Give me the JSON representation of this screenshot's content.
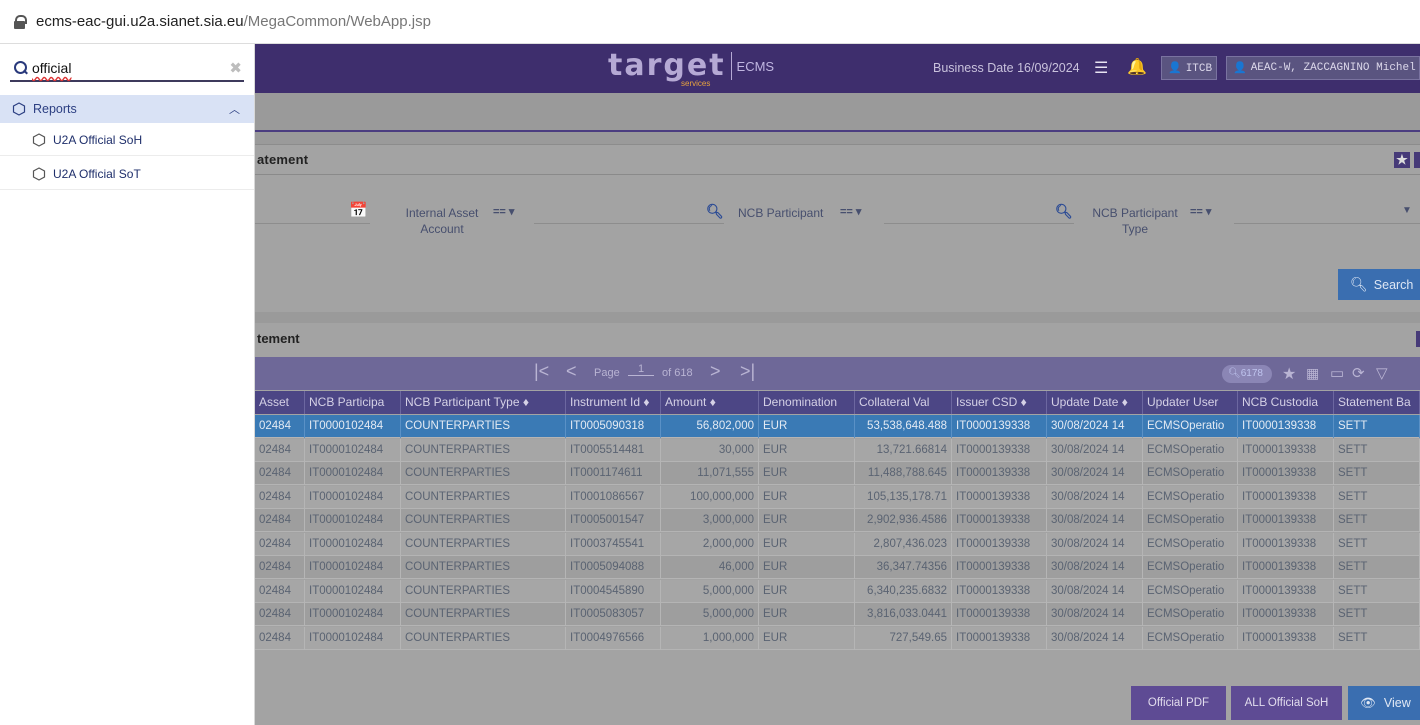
{
  "browser": {
    "url_host": "ecms-eac-gui.u2a.sianet.sia.eu",
    "url_path": "/MegaCommon/WebApp.jsp"
  },
  "header": {
    "logo_text": "target",
    "logo_sub": "services",
    "logo_brand": "ECMS",
    "business_date": "Business Date 16/09/2024",
    "party_button": "ITCB ▾",
    "user_button": "AEAC-W, ZACCAGNINO Michel"
  },
  "sidebar": {
    "search_value": "official",
    "category": "Reports",
    "items": [
      "U2A Official SoH",
      "U2A Official SoT"
    ]
  },
  "search_panel": {
    "title": "atement",
    "filters": {
      "internal_asset_label": "Internal Asset\nAccount",
      "internal_asset_op": "== ▾",
      "ncb_participant_label": "NCB Participant",
      "ncb_participant_op": "== ▾",
      "ncb_type_label": "NCB Participant\nType",
      "ncb_type_op": "== ▾"
    },
    "search_button": "Search"
  },
  "results_panel": {
    "title": "tement",
    "pager": {
      "page_label": "Page",
      "page_value": "1",
      "of_label": "of 618",
      "count": "6178"
    },
    "columns": [
      "Asset",
      "NCB Participa",
      "NCB Participant Type ♦",
      "Instrument Id ♦",
      "Amount ♦",
      "Denomination",
      "Collateral Val",
      "Issuer CSD ♦",
      "Update Date ♦",
      "Updater User",
      "NCB Custodia",
      "Statement Ba"
    ],
    "rows": [
      [
        "02484",
        "IT0000102484",
        "COUNTERPARTIES",
        "IT0005090318",
        "56,802,000",
        "EUR",
        "53,538,648.488",
        "IT0000139338",
        "30/08/2024 14",
        "ECMSOperatio",
        "IT0000139338",
        "SETT"
      ],
      [
        "02484",
        "IT0000102484",
        "COUNTERPARTIES",
        "IT0005514481",
        "30,000",
        "EUR",
        "13,721.66814",
        "IT0000139338",
        "30/08/2024 14",
        "ECMSOperatio",
        "IT0000139338",
        "SETT"
      ],
      [
        "02484",
        "IT0000102484",
        "COUNTERPARTIES",
        "IT0001174611",
        "11,071,555",
        "EUR",
        "11,488,788.645",
        "IT0000139338",
        "30/08/2024 14",
        "ECMSOperatio",
        "IT0000139338",
        "SETT"
      ],
      [
        "02484",
        "IT0000102484",
        "COUNTERPARTIES",
        "IT0001086567",
        "100,000,000",
        "EUR",
        "105,135,178.71",
        "IT0000139338",
        "30/08/2024 14",
        "ECMSOperatio",
        "IT0000139338",
        "SETT"
      ],
      [
        "02484",
        "IT0000102484",
        "COUNTERPARTIES",
        "IT0005001547",
        "3,000,000",
        "EUR",
        "2,902,936.4586",
        "IT0000139338",
        "30/08/2024 14",
        "ECMSOperatio",
        "IT0000139338",
        "SETT"
      ],
      [
        "02484",
        "IT0000102484",
        "COUNTERPARTIES",
        "IT0003745541",
        "2,000,000",
        "EUR",
        "2,807,436.023",
        "IT0000139338",
        "30/08/2024 14",
        "ECMSOperatio",
        "IT0000139338",
        "SETT"
      ],
      [
        "02484",
        "IT0000102484",
        "COUNTERPARTIES",
        "IT0005094088",
        "46,000",
        "EUR",
        "36,347.74356",
        "IT0000139338",
        "30/08/2024 14",
        "ECMSOperatio",
        "IT0000139338",
        "SETT"
      ],
      [
        "02484",
        "IT0000102484",
        "COUNTERPARTIES",
        "IT0004545890",
        "5,000,000",
        "EUR",
        "6,340,235.6832",
        "IT0000139338",
        "30/08/2024 14",
        "ECMSOperatio",
        "IT0000139338",
        "SETT"
      ],
      [
        "02484",
        "IT0000102484",
        "COUNTERPARTIES",
        "IT0005083057",
        "5,000,000",
        "EUR",
        "3,816,033.0441",
        "IT0000139338",
        "30/08/2024 14",
        "ECMSOperatio",
        "IT0000139338",
        "SETT"
      ],
      [
        "02484",
        "IT0000102484",
        "COUNTERPARTIES",
        "IT0004976566",
        "1,000,000",
        "EUR",
        "727,549.65",
        "IT0000139338",
        "30/08/2024 14",
        "ECMSOperatio",
        "IT0000139338",
        "SETT"
      ]
    ],
    "buttons": {
      "official_pdf": "Official PDF",
      "all_official_soh": "ALL Official SoH",
      "view": "View"
    }
  },
  "colors": {
    "header_bg": "#3e2e6d",
    "overlay_gray": "#9a9a9a",
    "selected_row": "#3a7ab5",
    "sidebar_category_bg": "#d9e2f5",
    "accent_blue": "#3a6eb0"
  }
}
